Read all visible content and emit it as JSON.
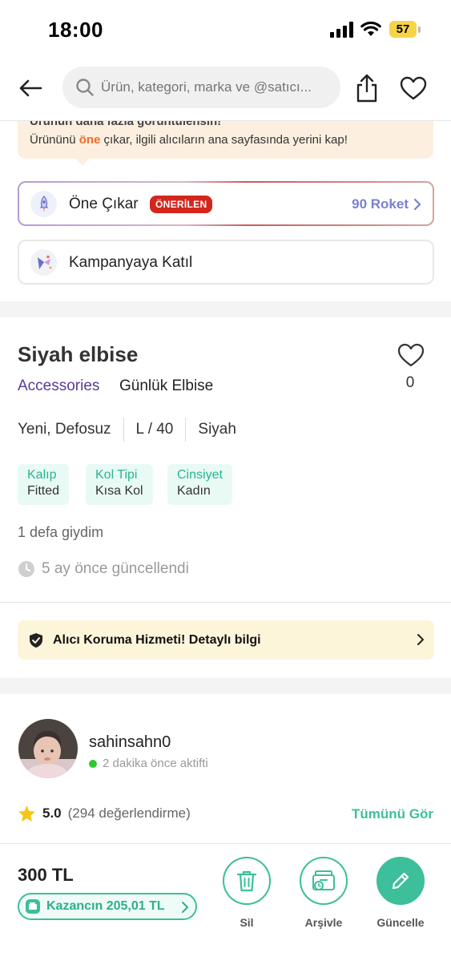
{
  "status_bar": {
    "time": "18:00",
    "battery": "57"
  },
  "header": {
    "search_placeholder": "Ürün, kategori, marka ve @satıcı..."
  },
  "promo_tip": {
    "title_cut": "Ürünün daha fazla görüntülensin!",
    "text_before": "Ürününü ",
    "text_highlight": "öne",
    "text_after": " çıkar, ilgili alıcıların ana sayfasında yerini kap!"
  },
  "boost": {
    "label": "Öne Çıkar",
    "badge": "ÖNERİLEN",
    "price": "90 Roket"
  },
  "campaign": {
    "label": "Kampanyaya Katıl"
  },
  "product": {
    "title": "Siyah elbise",
    "like_count": "0",
    "category_main": "Accessories",
    "category_sub": "Günlük Elbise",
    "attributes": [
      "Yeni, Defosuz",
      "L / 40",
      "Siyah"
    ],
    "chips": [
      {
        "key": "Kalıp",
        "value": "Fitted"
      },
      {
        "key": "Kol Tipi",
        "value": "Kısa Kol"
      },
      {
        "key": "Cinsiyet",
        "value": "Kadın"
      }
    ],
    "worn_text": "1 defa giydim",
    "updated_text": "5 ay önce güncellendi"
  },
  "protection": {
    "text": "Alıcı Koruma Hizmeti! Detaylı bilgi"
  },
  "seller": {
    "username": "sahinsahn0",
    "status": "2 dakika önce aktifti",
    "rating": "5.0",
    "rating_count": "(294 değerlendirme)",
    "see_all": "Tümünü Gör"
  },
  "bottom_bar": {
    "price": "300 TL",
    "earnings": "Kazancın 205,01 TL",
    "actions": {
      "delete": "Sil",
      "archive": "Arşivle",
      "update": "Güncelle"
    }
  },
  "colors": {
    "accent_green": "#3cbf9a",
    "category_purple": "#5b3a91",
    "badge_red": "#d3261d",
    "rocket_purple": "#7b7fd1"
  }
}
